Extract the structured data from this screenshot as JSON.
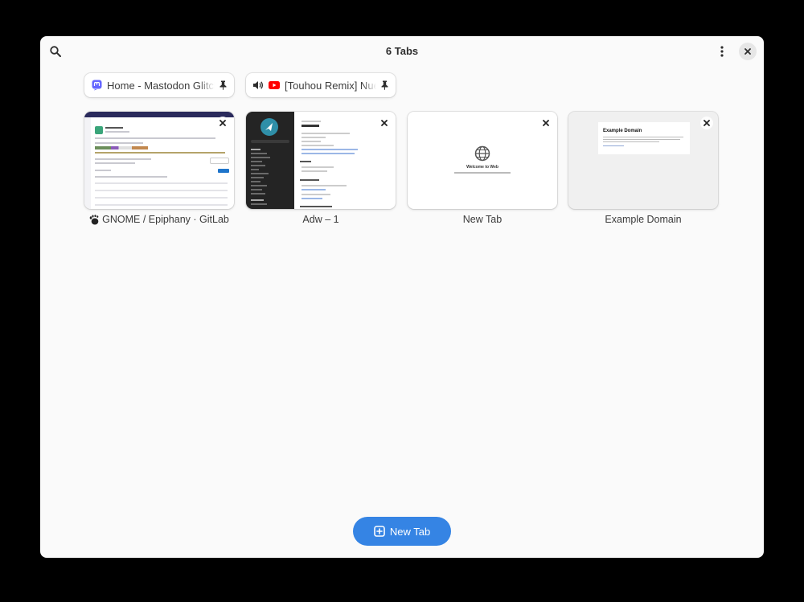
{
  "header": {
    "title": "6 Tabs"
  },
  "pinned_tabs": [
    {
      "title": "Home - Mastodon Glitch Edition",
      "favicon": "mastodon-icon"
    },
    {
      "title": "[Touhou Remix] Nue",
      "favicon": "youtube-icon",
      "audio": "speaker-icon"
    }
  ],
  "tabs": [
    {
      "title": "GNOME / Epiphany · GitLab",
      "favicon": "gnome-foot-icon"
    },
    {
      "title": "Adw – 1"
    },
    {
      "title": "New Tab",
      "thumb_heading": "Welcome to Web"
    },
    {
      "title": "Example Domain",
      "thumb_heading": "Example Domain"
    }
  ],
  "new_tab_button": {
    "label": "New Tab"
  },
  "colors": {
    "accent": "#3584e4",
    "window_bg": "#fafafa"
  }
}
